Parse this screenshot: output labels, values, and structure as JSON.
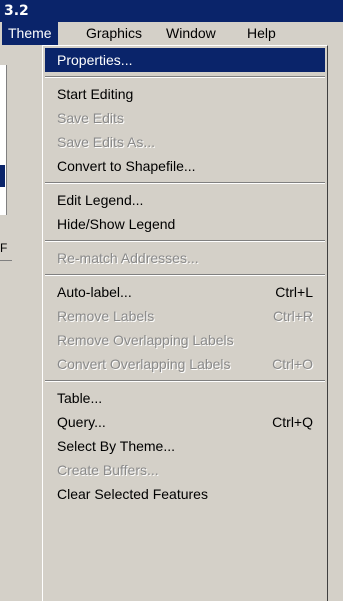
{
  "title_bar": {
    "text": "3.2"
  },
  "menubar": {
    "items": [
      {
        "label": "Theme"
      },
      {
        "label": "Graphics"
      },
      {
        "label": "Window"
      },
      {
        "label": "Help"
      }
    ]
  },
  "left_window": {
    "partial_letter": "F"
  },
  "menu": {
    "groups": [
      [
        {
          "label": "Properties...",
          "shortcut": "",
          "disabled": false,
          "highlighted": true
        }
      ],
      [
        {
          "label": "Start Editing",
          "shortcut": "",
          "disabled": false
        },
        {
          "label": "Save Edits",
          "shortcut": "",
          "disabled": true
        },
        {
          "label": "Save Edits As...",
          "shortcut": "",
          "disabled": true
        },
        {
          "label": "Convert to Shapefile...",
          "shortcut": "",
          "disabled": false
        }
      ],
      [
        {
          "label": "Edit Legend...",
          "shortcut": "",
          "disabled": false
        },
        {
          "label": "Hide/Show Legend",
          "shortcut": "",
          "disabled": false
        }
      ],
      [
        {
          "label": "Re-match Addresses...",
          "shortcut": "",
          "disabled": true
        }
      ],
      [
        {
          "label": "Auto-label...",
          "shortcut": "Ctrl+L",
          "disabled": false
        },
        {
          "label": "Remove Labels",
          "shortcut": "Ctrl+R",
          "disabled": true
        },
        {
          "label": "Remove Overlapping Labels",
          "shortcut": "",
          "disabled": true
        },
        {
          "label": "Convert Overlapping Labels",
          "shortcut": "Ctrl+O",
          "disabled": true
        }
      ],
      [
        {
          "label": "Table...",
          "shortcut": "",
          "disabled": false
        },
        {
          "label": "Query...",
          "shortcut": "Ctrl+Q",
          "disabled": false
        },
        {
          "label": "Select By Theme...",
          "shortcut": "",
          "disabled": false
        },
        {
          "label": "Create Buffers...",
          "shortcut": "",
          "disabled": true
        },
        {
          "label": "Clear Selected Features",
          "shortcut": "",
          "disabled": false
        }
      ]
    ]
  },
  "colors": {
    "highlight": "#0a246a",
    "menu_bg": "#d4d0c8",
    "disabled_text": "#8a8a8a"
  }
}
